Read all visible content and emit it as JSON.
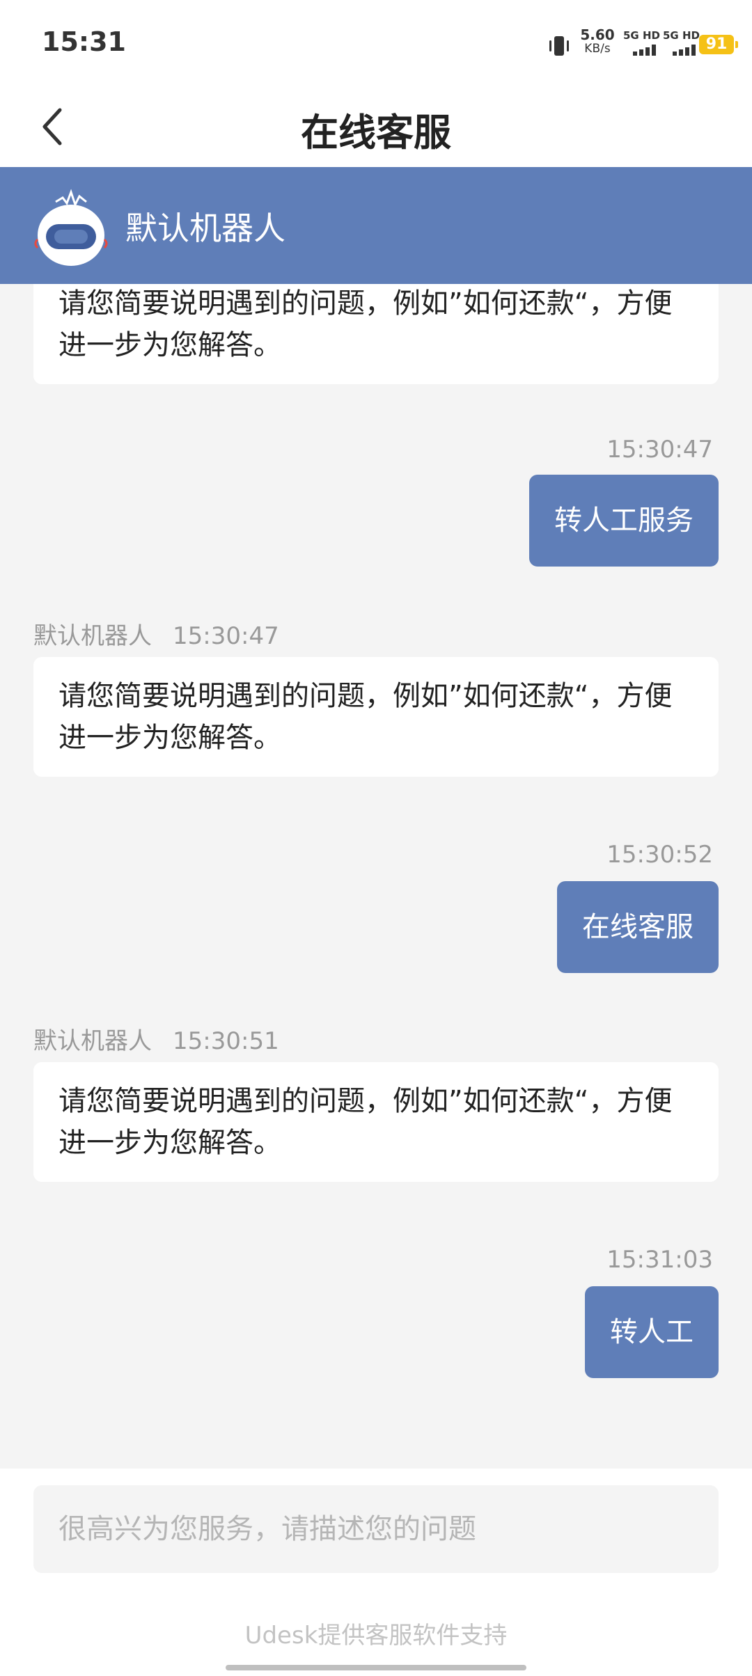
{
  "status_bar": {
    "time": "15:31",
    "net_speed_value": "5.60",
    "net_speed_unit": "KB/s",
    "signal_1_label": "5G HD",
    "signal_2_label": "5G HD",
    "battery_level": "91",
    "battery_color": "#f5c116"
  },
  "header": {
    "title": "在线客服",
    "back_icon": "chevron-left-icon"
  },
  "bot_banner": {
    "name": "默认机器人",
    "avatar_icon": "robot-avatar-icon",
    "background": "#5f7eb8"
  },
  "messages": [
    {
      "side": "left",
      "text": "请您简要说明遇到的问题，例如”如何还款“，方便进一步为您解答。"
    },
    {
      "side": "right",
      "time": "15:30:47",
      "text": "转人工服务"
    },
    {
      "side": "left",
      "sender": "默认机器人",
      "time": "15:30:47",
      "text": "请您简要说明遇到的问题，例如”如何还款“，方便进一步为您解答。"
    },
    {
      "side": "right",
      "time": "15:30:52",
      "text": "在线客服"
    },
    {
      "side": "left",
      "sender": "默认机器人",
      "time": "15:30:51",
      "text": "请您简要说明遇到的问题，例如”如何还款“，方便进一步为您解答。"
    },
    {
      "side": "right",
      "time": "15:31:03",
      "text": "转人工"
    }
  ],
  "input": {
    "placeholder": "很高兴为您服务，请描述您的问题",
    "value": ""
  },
  "footer": {
    "powered_by": "Udesk提供客服软件支持"
  }
}
